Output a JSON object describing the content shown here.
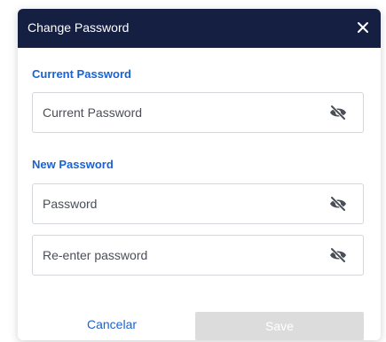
{
  "dialog": {
    "title": "Change Password",
    "close_icon": "close-icon"
  },
  "current_section": {
    "label": "Current Password",
    "field": {
      "placeholder": "Current Password",
      "value": "",
      "icon": "eye-slash-icon"
    }
  },
  "new_section": {
    "label": "New Password",
    "password_field": {
      "placeholder": "Password",
      "value": "",
      "icon": "eye-slash-icon"
    },
    "reenter_field": {
      "placeholder": "Re-enter password",
      "value": "",
      "icon": "eye-slash-icon"
    }
  },
  "footer": {
    "cancel_label": "Cancelar",
    "save_label": "Save",
    "save_disabled": true
  },
  "colors": {
    "header_bg": "#141f42",
    "accent": "#1a62d1",
    "disabled_button": "#dcdcdc"
  }
}
